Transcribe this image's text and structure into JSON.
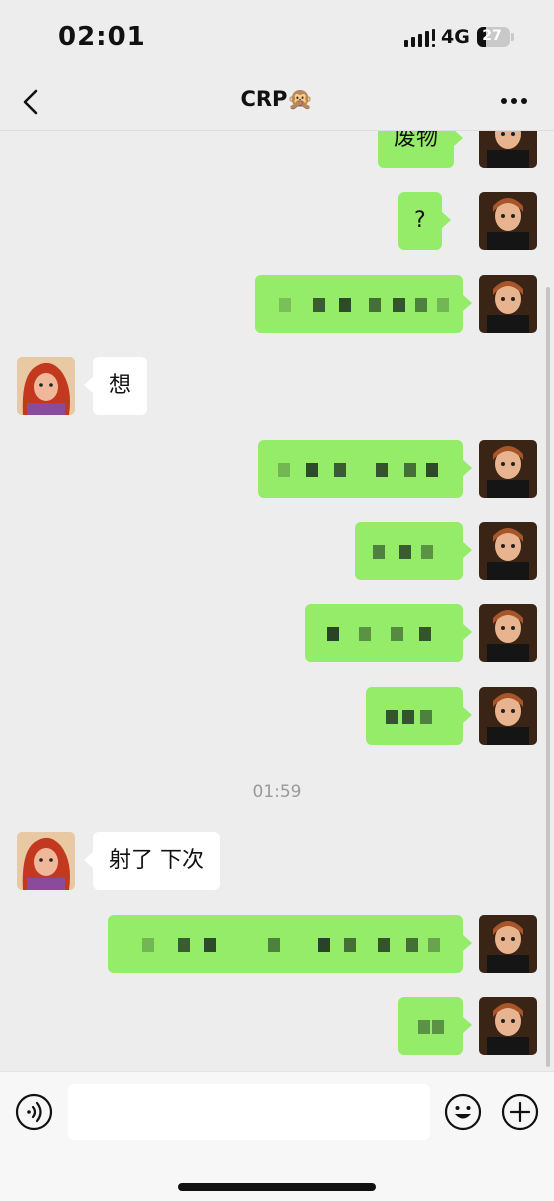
{
  "status_bar": {
    "time": "02:01",
    "network": "4G",
    "battery": "27",
    "battery_level": 0.27
  },
  "header": {
    "back_icon": "chevron-left-icon",
    "title": "CRP🙊",
    "more_icon": "ellipsis-icon"
  },
  "messages": [
    {
      "from": "me",
      "text": "废物"
    },
    {
      "from": "me",
      "text": "?"
    },
    {
      "from": "me",
      "text": "",
      "pixelated": true
    },
    {
      "from": "them",
      "text": "想"
    },
    {
      "from": "me",
      "text": "",
      "pixelated": true
    },
    {
      "from": "me",
      "text": "",
      "pixelated": true
    },
    {
      "from": "me",
      "text": "",
      "pixelated": true
    },
    {
      "from": "me",
      "text": "",
      "pixelated": true
    },
    {
      "from": "them",
      "text": "射了 下次"
    },
    {
      "from": "me",
      "text": "",
      "pixelated": true
    },
    {
      "from": "me",
      "text": "",
      "pixelated": true
    }
  ],
  "timestamp": "01:59",
  "input_bar": {
    "voice_icon": "voice-icon",
    "emoji_icon": "emoji-icon",
    "add_icon": "plus-circle-icon",
    "value": "",
    "placeholder": ""
  },
  "colors": {
    "background": "#ededed",
    "sent_bubble": "#95ec69",
    "received_bubble": "#ffffff",
    "timestamp": "#9a9a9a",
    "input_bar": "#f7f7f7"
  }
}
